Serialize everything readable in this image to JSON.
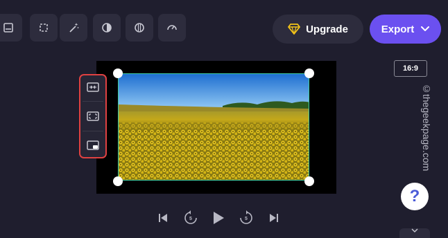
{
  "toolbar": {
    "tools": [
      {
        "icon": "captions-icon"
      },
      {
        "icon": "crop-icon"
      },
      {
        "icon": "magic-wand-icon"
      },
      {
        "icon": "adjust-colors-icon"
      },
      {
        "icon": "fade-icon"
      },
      {
        "icon": "speed-icon"
      }
    ],
    "upgrade_label": "Upgrade",
    "upgrade_icon": "diamond-icon",
    "export_label": "Export",
    "export_icon": "chevron-down-icon"
  },
  "preview": {
    "aspect_ratio": "16:9",
    "side_tools": [
      "fit-icon",
      "fill-icon",
      "picture-in-picture-icon"
    ]
  },
  "playback": {
    "skip_back_seconds": "5",
    "skip_forward_seconds": "5"
  },
  "watermark": "©thegeekpage.com",
  "help_label": "?",
  "colors": {
    "background": "#1f1e2e",
    "accent": "#6b50f0",
    "highlight": "#e04141",
    "selection": "#3fcfa5",
    "upgrade_icon": "#f5c518"
  }
}
